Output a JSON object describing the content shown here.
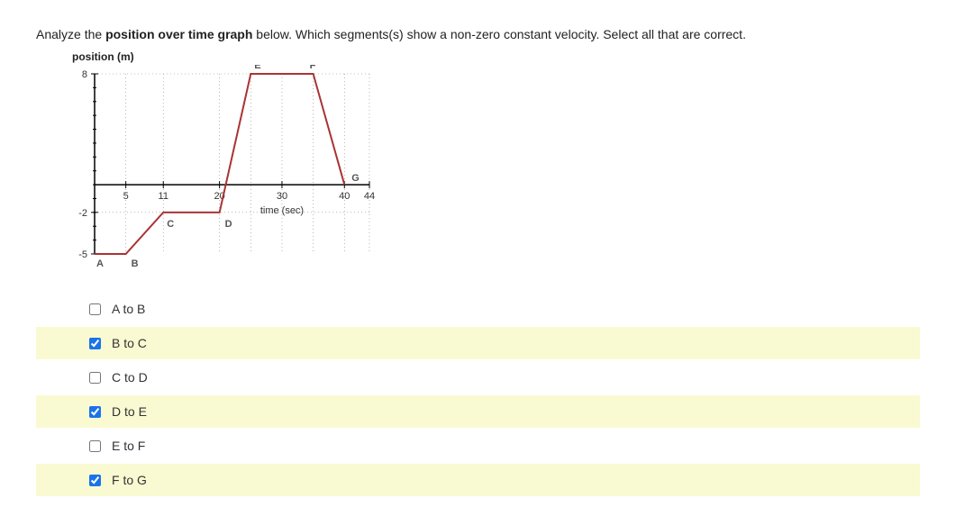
{
  "question": {
    "pre": "Analyze the ",
    "bold": "position over time graph",
    "post": " below.  Which segments(s) show a non-zero constant velocity.  Select all that are correct."
  },
  "ylabel": "position (m)",
  "xlabel": "time (sec)",
  "options": [
    {
      "label": "A to B",
      "checked": false
    },
    {
      "label": "B to C",
      "checked": true
    },
    {
      "label": "C to D",
      "checked": false
    },
    {
      "label": "D to E",
      "checked": true
    },
    {
      "label": "E to F",
      "checked": false
    },
    {
      "label": "F to G",
      "checked": true
    }
  ],
  "chart_data": {
    "type": "line",
    "title": "position over time graph",
    "xlabel": "time (sec)",
    "ylabel": "position (m)",
    "ylim": [
      -5,
      8
    ],
    "xlim": [
      0,
      44
    ],
    "x_ticks": [
      5,
      11,
      20,
      30,
      40,
      44
    ],
    "y_ticks": [
      -5,
      -2,
      8
    ],
    "points": [
      {
        "label": "A",
        "t": 0,
        "y": -5
      },
      {
        "label": "B",
        "t": 5,
        "y": -5
      },
      {
        "label": "C",
        "t": 11,
        "y": -2
      },
      {
        "label": "D",
        "t": 20,
        "y": -2
      },
      {
        "label": "E",
        "t": 25,
        "y": 8
      },
      {
        "label": "F",
        "t": 35,
        "y": 8
      },
      {
        "label": "G",
        "t": 40,
        "y": 0
      }
    ],
    "point_labels": [
      "A",
      "B",
      "C",
      "D",
      "E",
      "F",
      "G"
    ]
  }
}
